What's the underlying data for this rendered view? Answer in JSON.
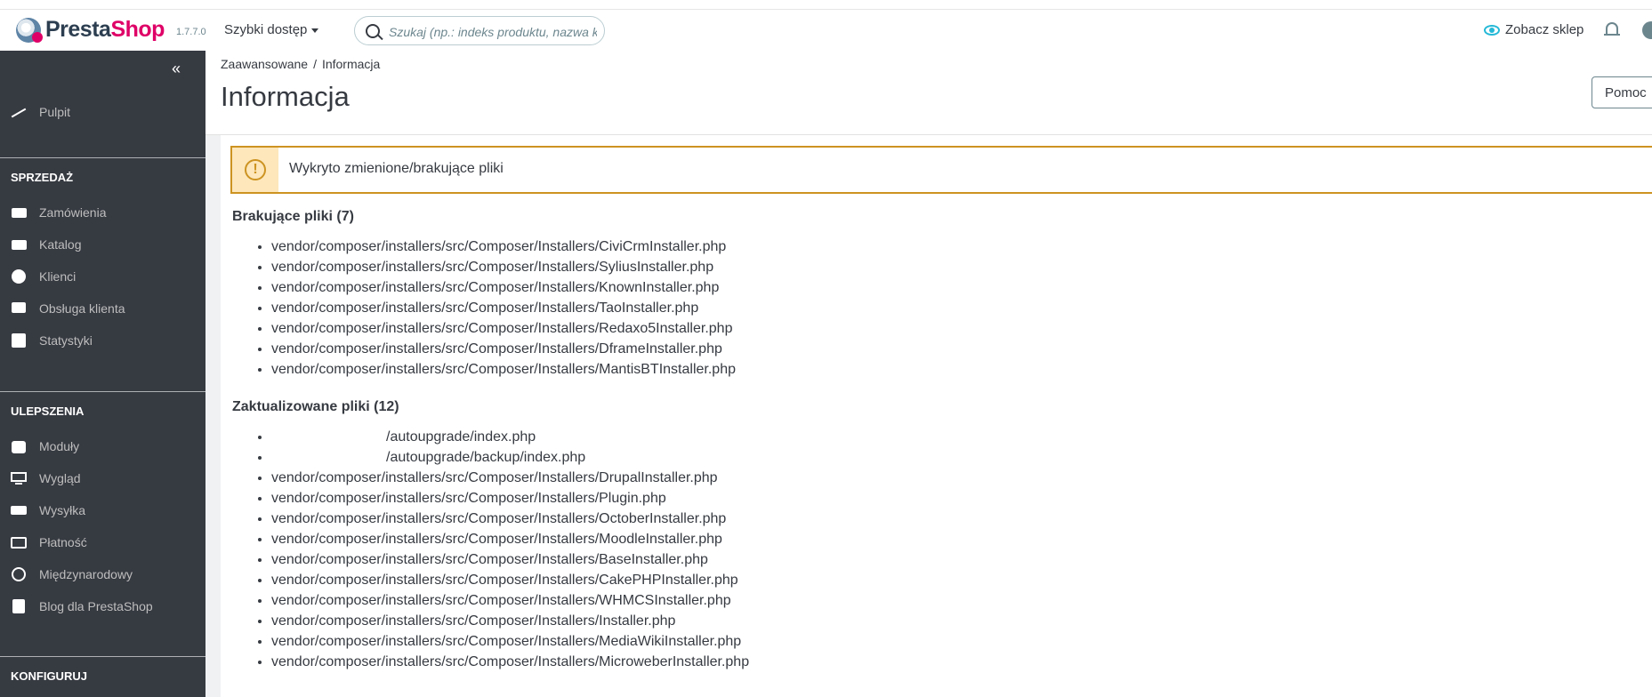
{
  "header": {
    "logo_text_a": "Presta",
    "logo_text_b": "Shop",
    "version": "1.7.7.0",
    "quick_access": "Szybki dostęp",
    "search_placeholder": "Szukaj (np.: indeks produktu, nazwa klienta...)",
    "view_shop": "Zobacz sklep"
  },
  "sidebar": {
    "collapse": "«",
    "dashboard": "Pulpit",
    "sections": [
      {
        "title": "SPRZEDAŻ",
        "items": [
          "Zamówienia",
          "Katalog",
          "Klienci",
          "Obsługa klienta",
          "Statystyki"
        ]
      },
      {
        "title": "ULEPSZENIA",
        "items": [
          "Moduły",
          "Wygląd",
          "Wysyłka",
          "Płatność",
          "Międzynarodowy",
          "Blog dla PrestaShop"
        ]
      },
      {
        "title": "KONFIGURUJ",
        "items": []
      }
    ]
  },
  "toolbar": {
    "breadcrumb": [
      "Zaawansowane",
      "Informacja"
    ],
    "breadcrumb_sep": "/",
    "title": "Informacja",
    "help": "Pomoc"
  },
  "alert": {
    "icon": "!",
    "text": "Wykryto zmienione/brakujące pliki"
  },
  "missing": {
    "title": "Brakujące pliki (7)",
    "files": [
      "vendor/composer/installers/src/Composer/Installers/CiviCrmInstaller.php",
      "vendor/composer/installers/src/Composer/Installers/SyliusInstaller.php",
      "vendor/composer/installers/src/Composer/Installers/KnownInstaller.php",
      "vendor/composer/installers/src/Composer/Installers/TaoInstaller.php",
      "vendor/composer/installers/src/Composer/Installers/Redaxo5Installer.php",
      "vendor/composer/installers/src/Composer/Installers/DframeInstaller.php",
      "vendor/composer/installers/src/Composer/Installers/MantisBTInstaller.php"
    ]
  },
  "updated": {
    "title": "Zaktualizowane pliki (12)",
    "files": [
      "/autoupgrade/index.php",
      "/autoupgrade/backup/index.php",
      "vendor/composer/installers/src/Composer/Installers/DrupalInstaller.php",
      "vendor/composer/installers/src/Composer/Installers/Plugin.php",
      "vendor/composer/installers/src/Composer/Installers/OctoberInstaller.php",
      "vendor/composer/installers/src/Composer/Installers/MoodleInstaller.php",
      "vendor/composer/installers/src/Composer/Installers/BaseInstaller.php",
      "vendor/composer/installers/src/Composer/Installers/CakePHPInstaller.php",
      "vendor/composer/installers/src/Composer/Installers/WHMCSInstaller.php",
      "vendor/composer/installers/src/Composer/Installers/Installer.php",
      "vendor/composer/installers/src/Composer/Installers/MediaWikiInstaller.php",
      "vendor/composer/installers/src/Composer/Installers/MicroweberInstaller.php"
    ]
  },
  "colors": {
    "brand": "#df0067",
    "sidebar_bg": "#363a41",
    "accent": "#25b9d7",
    "warning": "#cd9321"
  }
}
